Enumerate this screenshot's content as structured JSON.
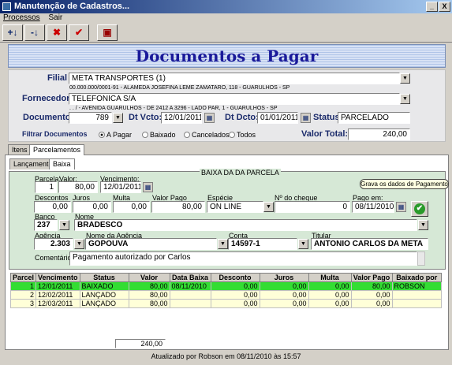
{
  "window": {
    "title": "Manutenção de Cadastros...",
    "minimize": "_",
    "close": "X"
  },
  "menu": [
    "Processos",
    "Sair"
  ],
  "toolbar": {
    "btn1": "+↓",
    "btn2": "-↓",
    "btn3": "✖",
    "btn4": "✔",
    "btn5": "▣"
  },
  "banner": "Documentos a Pagar",
  "header": {
    "filial_label": "Filial",
    "filial_value": "META TRANSPORTES (1)",
    "filial_addr": "00.000.000/0001-91 - ALAMEDA JOSEFINA LEME ZAMATARO, 118 - GUARULHOS - SP",
    "fornecedor_label": "Fornecedor",
    "fornecedor_value": "TELEFONICA S/A",
    "fornecedor_addr": ". . / - AVENIDA GUARULHOS - DE 2412 A 3296 - LADO PAR, 1 - GUARULHOS - SP",
    "documento_label": "Documento",
    "documento_value": "789",
    "dtvcto_label": "Dt Vcto:",
    "dtvcto_value": "12/01/2011",
    "dtdcto_label": "Dt Dcto:",
    "dtdcto_value": "01/01/2011",
    "status_label": "Status:",
    "status_value": "PARCELADO",
    "filtrar_label": "Filtrar Documentos",
    "radios": [
      "A Pagar",
      "Baixado",
      "Cancelados",
      "Todos"
    ],
    "valor_total_label": "Valor Total:",
    "valor_total_value": "240,00"
  },
  "tabs": {
    "itens": "Itens",
    "parcelamentos": "Parcelamentos",
    "lancamento": "Lançamento",
    "baixa": "Baixa"
  },
  "baixa": {
    "title": "BAIXA DA DA PARCELA",
    "parcela_label": "Parcela:",
    "parcela_value": "1",
    "valor_label": "Valor:",
    "valor_value": "80,00",
    "vencimento_label": "Vencimento:",
    "vencimento_value": "12/01/2011",
    "descontos_label": "Descontos",
    "descontos_value": "0,00",
    "juros_label": "Juros",
    "juros_value": "0,00",
    "multa_label": "Multa",
    "multa_value": "0,00",
    "valorpago_label": "Valor Pago",
    "valorpago_value": "80,00",
    "especie_label": "Espécie",
    "especie_value": "ON LINE",
    "cheque_label": "Nº do cheque",
    "cheque_value": "0",
    "pagoem_label": "Pago em:",
    "pagoem_value": "08/11/2010",
    "tooltip": "Grava os dados de Pagamento",
    "banco_label": "Banco",
    "banco_value": "237",
    "nome_label": "Nome",
    "nome_value": "BRADESCO",
    "agencia_label": "Agência",
    "agencia_value": "2.303",
    "nomeagencia_label": "Nome da Agência",
    "nomeagencia_value": "GOPOUVA",
    "conta_label": "Conta",
    "conta_value": "14597-1",
    "titular_label": "Titular",
    "titular_value": "ANTONIO CARLOS DA META",
    "comentarios_label": "Comentários:",
    "comentarios_value": "Pagamento autorizado por Carlos"
  },
  "grid": {
    "headers": [
      "Parcel",
      "Vencimento",
      "Status",
      "Valor",
      "Data Baixa",
      "Desconto",
      "Juros",
      "Multa",
      "Valor Pago",
      "Baixado por"
    ],
    "rows": [
      [
        "1",
        "12/01/2011",
        "BAIXADO",
        "80,00",
        "08/11/2010",
        "0,00",
        "0,00",
        "0,00",
        "80,00",
        "ROBSON"
      ],
      [
        "2",
        "12/02/2011",
        "LANÇADO",
        "80,00",
        "",
        "0,00",
        "0,00",
        "0,00",
        "0,00",
        ""
      ],
      [
        "3",
        "12/03/2011",
        "LANÇADO",
        "80,00",
        "",
        "0,00",
        "0,00",
        "0,00",
        "0,00",
        ""
      ]
    ],
    "total": "240,00"
  },
  "status_text": "Atualizado por Robson em 08/11/2010 às 15:57"
}
